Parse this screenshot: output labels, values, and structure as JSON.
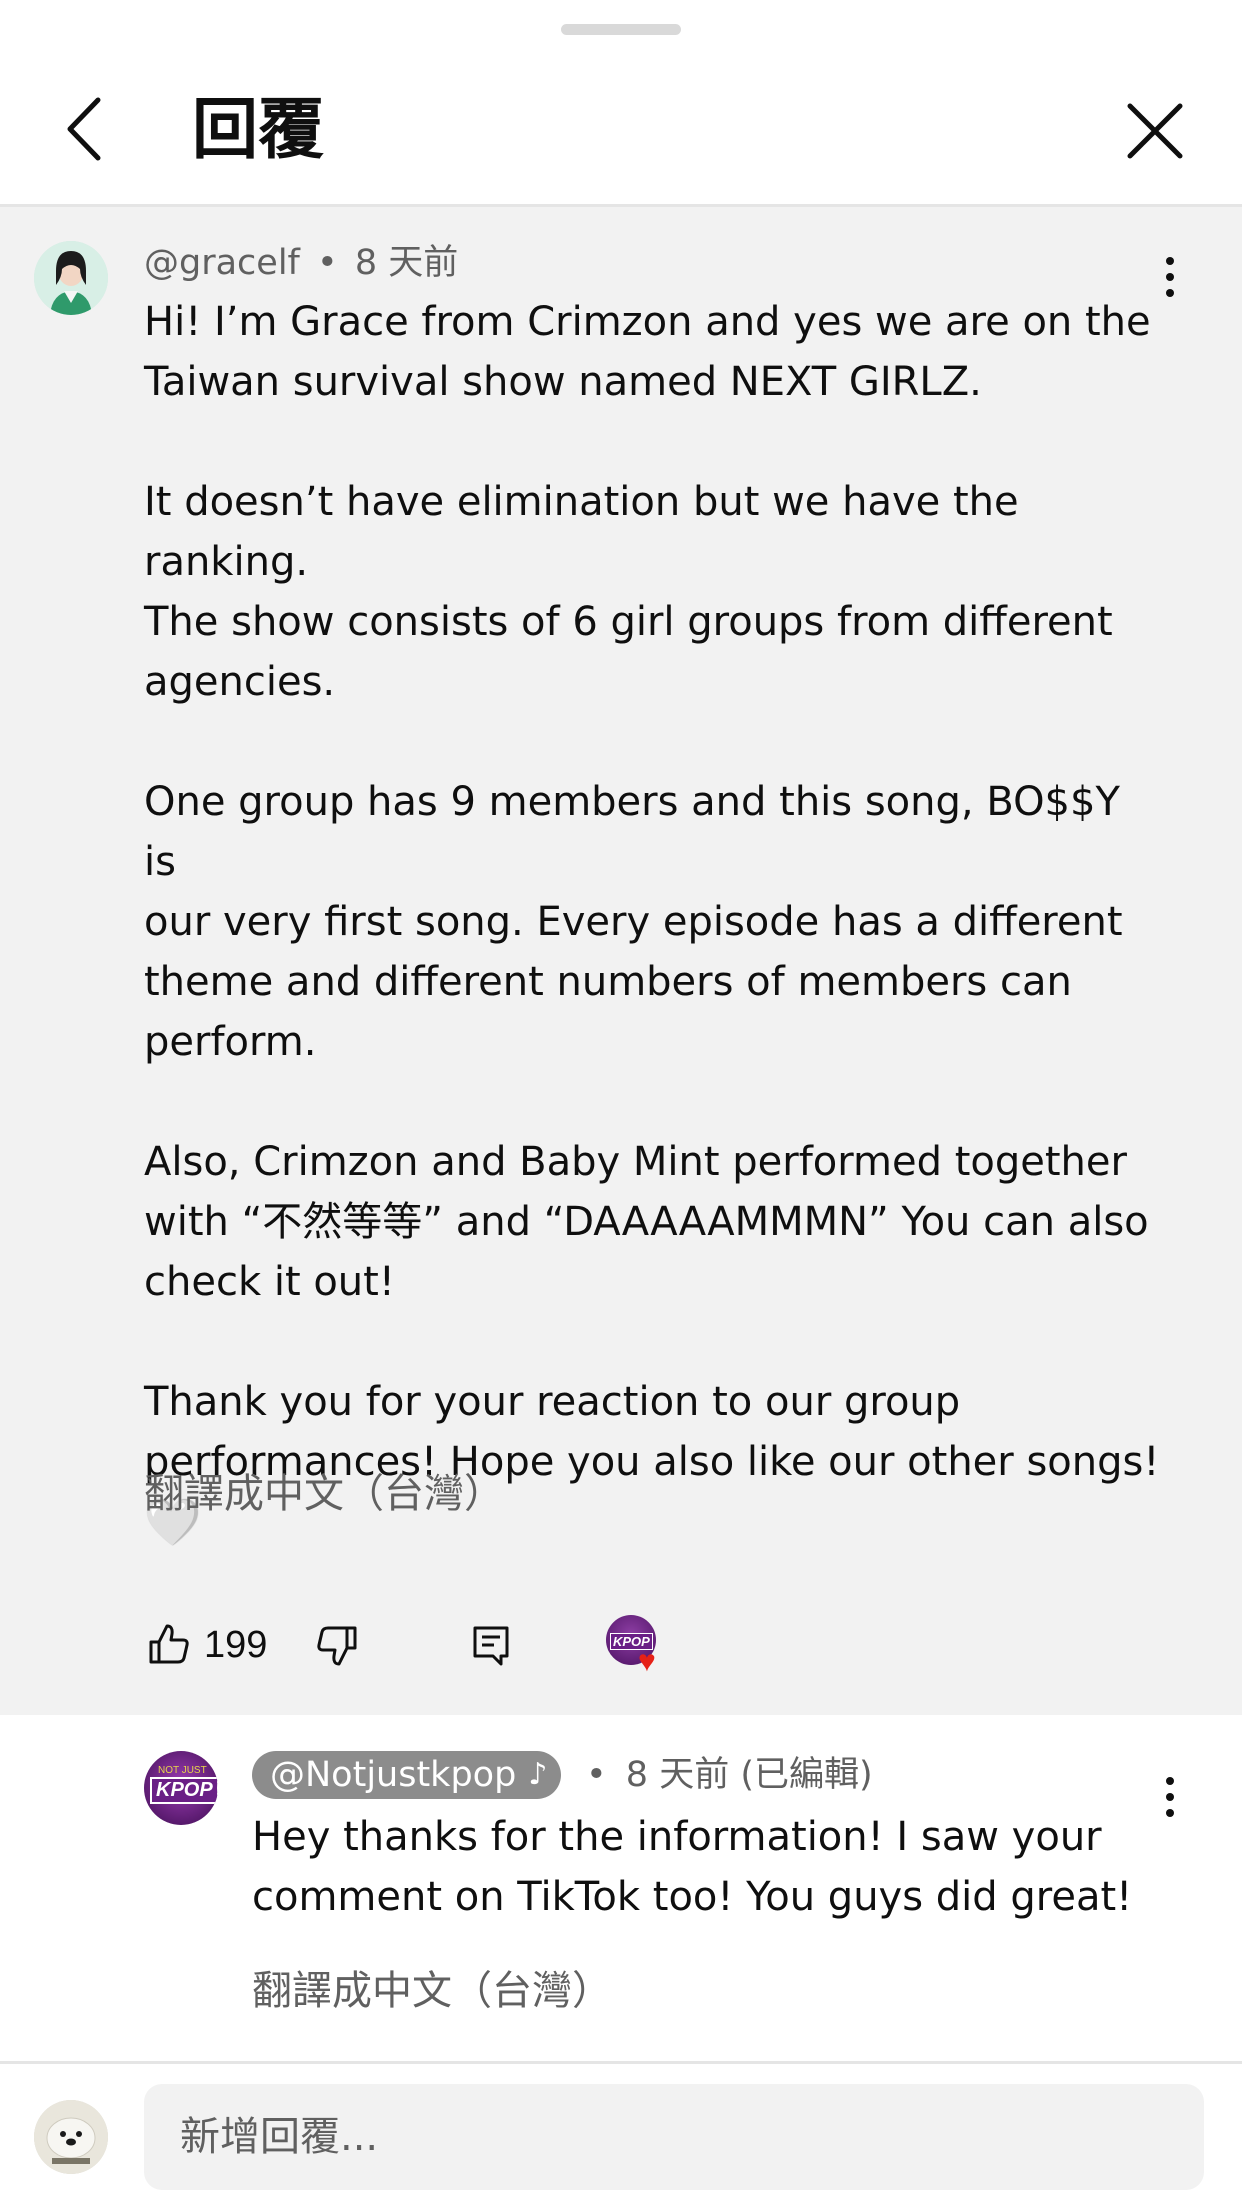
{
  "header": {
    "title": "回覆"
  },
  "parent_comment": {
    "author": "@gracelf",
    "separator": "•",
    "time": "8 天前",
    "paragraphs": [
      "Hi! I’m Grace from Crimzon and yes we are on the\nTaiwan survival show named NEXT GIRLZ.",
      "It doesn’t have elimination but we have the ranking.\nThe show consists of 6 girl groups from different\nagencies.",
      "One group has 9 members and this song, BO$$Y is\nour very first song. Every episode has a different\ntheme and different numbers of members can\nperform.",
      "Also, Crimzon and Baby Mint performed together\nwith “不然等等” and “DAAAAAMMMN” You can also\ncheck it out!",
      "Thank you for your reaction to our group\nperformances! Hope you also like our other songs!"
    ],
    "emoji": "🤍",
    "translate_label": "翻譯成中文（台灣）",
    "like_count": "199"
  },
  "reply": {
    "author": "@Notjustkpop",
    "music_note": "♪",
    "separator": "•",
    "time": "8 天前 (已編輯)",
    "text": "Hey thanks for the information! I saw your\ncomment on TikTok too! You guys did great!",
    "translate_label": "翻譯成中文（台灣）",
    "avatar_text": "KPOP"
  },
  "composer": {
    "placeholder": "新增回覆..."
  },
  "colors": {
    "background": "#ffffff",
    "highlight_background": "#f2f2f2",
    "secondary_text": "#606060",
    "creator_chip": "#8c8c8c",
    "heart_red": "#e62117"
  }
}
